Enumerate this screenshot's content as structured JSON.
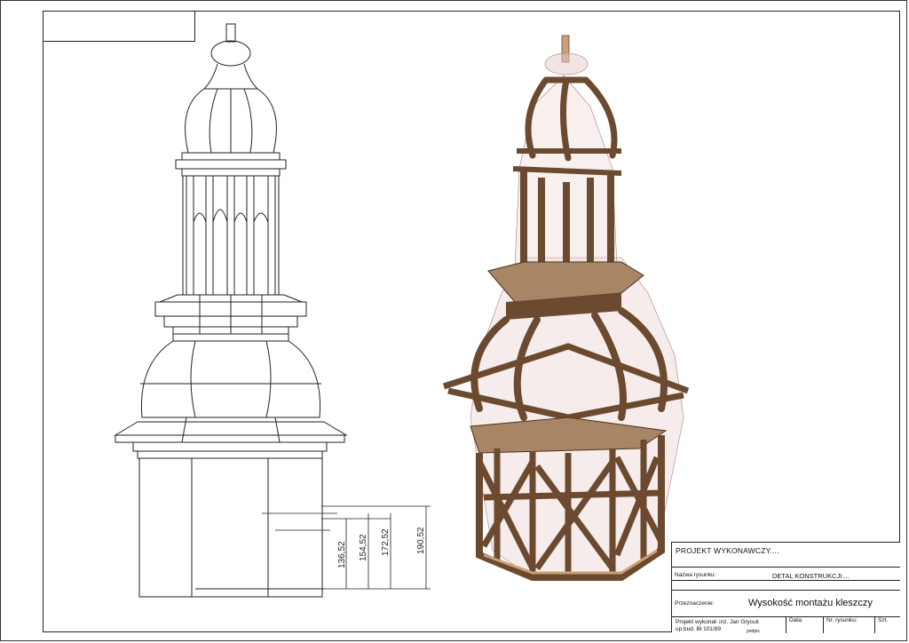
{
  "title_block": {
    "project_label": "PROJEKT WYKONAWCZY....",
    "drawing_name_label": "Nazwa rysunku:",
    "drawing_name_value": "DETAL KONSTRUKCJI....",
    "purpose_label": "Przeznaczenie:",
    "purpose_value": "Wysokość montażu kleszczy",
    "author_line1": "Projekt wykonał: inż. Jan Grycuk",
    "author_line2": "up.bud. Bł 101/89",
    "sign_label": "podpis",
    "date_label": "Data:",
    "drawing_no_label": "Nr. rysunku:",
    "sheet_label": "Szt."
  },
  "dimensions": [
    "136,52",
    "154,52",
    "172,52",
    "190,52"
  ],
  "colors": {
    "line": "#222222",
    "timber": "#6b4a30",
    "timber_light": "#a88565",
    "glass": "#e8c9c9"
  }
}
